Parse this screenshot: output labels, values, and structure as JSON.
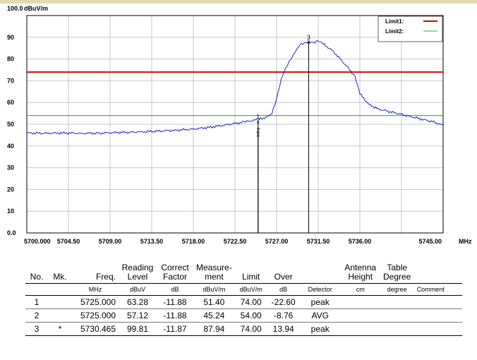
{
  "chart_data": {
    "type": "line",
    "ylabel": "dBuV/m",
    "ylabel_max_tick": "100.0",
    "xlabel": "MHz",
    "ylim": [
      0,
      100
    ],
    "xlim": [
      5700.0,
      5745.0
    ],
    "x_ticks": [
      "5700.000",
      "5704.50",
      "5709.00",
      "5713.50",
      "5718.00",
      "5722.50",
      "5727.00",
      "5731.50",
      "5736.00",
      "5745.00"
    ],
    "x_tick_values": [
      5700.0,
      5704.5,
      5709.0,
      5713.5,
      5718.0,
      5722.5,
      5727.0,
      5731.5,
      5736.0,
      5745.0
    ],
    "y_ticks": [
      "0.0",
      "10",
      "20",
      "30",
      "40",
      "50",
      "60",
      "70",
      "80",
      "90"
    ],
    "y_tick_values": [
      0,
      10,
      20,
      30,
      40,
      50,
      60,
      70,
      80,
      90
    ],
    "grid": true,
    "legend": {
      "placement": "top-right",
      "entries": [
        {
          "name": "Limit1:",
          "color": "#dd0000"
        },
        {
          "name": "Limit2:",
          "color": "#22bb22"
        }
      ]
    },
    "limits": [
      {
        "name": "Limit1:",
        "value": 74,
        "color": "#dd0000"
      },
      {
        "name": "Limit2:",
        "value": 54,
        "color": "#22bb22"
      }
    ],
    "series": [
      {
        "color": "#2222cc",
        "x": [
          5700.0,
          5702.0,
          5704.0,
          5706.0,
          5708.0,
          5710.0,
          5712.0,
          5714.0,
          5716.0,
          5718.0,
          5720.0,
          5722.0,
          5723.5,
          5725.0,
          5726.0,
          5726.5,
          5727.0,
          5727.5,
          5728.0,
          5728.5,
          5729.0,
          5729.5,
          5730.0,
          5730.465,
          5731.0,
          5731.5,
          5732.0,
          5733.0,
          5734.0,
          5735.0,
          5735.5,
          5735.6,
          5736.0,
          5737.0,
          5738.0,
          5739.0,
          5740.0,
          5741.0,
          5742.0,
          5743.0,
          5744.0,
          5745.0
        ],
        "y": [
          46.0,
          45.8,
          46.0,
          45.8,
          45.9,
          46.2,
          46.4,
          46.8,
          47.2,
          47.8,
          48.7,
          50.0,
          51.0,
          52.2,
          53.3,
          55.0,
          62.0,
          71.0,
          76.0,
          79.5,
          83.0,
          86.5,
          87.6,
          88.0,
          87.5,
          88.2,
          87.0,
          84.0,
          79.5,
          74.5,
          72.0,
          70.0,
          64.0,
          59.0,
          57.0,
          56.0,
          55.0,
          54.0,
          53.0,
          52.0,
          51.0,
          49.5
        ]
      }
    ],
    "markers": [
      {
        "label": "1",
        "x": 5725.0,
        "y": 51.4
      },
      {
        "label": "2",
        "x": 5725.0,
        "y": 45.24
      },
      {
        "label": "3",
        "x": 5730.465,
        "y": 87.94
      }
    ]
  },
  "table": {
    "headers": {
      "no": "No.",
      "mk": "Mk.",
      "freq": "Freq.",
      "reading": [
        "Reading",
        "Level"
      ],
      "correct": [
        "Correct",
        "Factor"
      ],
      "measure": [
        "Measure-",
        "ment"
      ],
      "limit": "Limit",
      "over": "Over",
      "detector": "",
      "antenna": [
        "Antenna",
        "Height"
      ],
      "table_deg": [
        "Table",
        "Degree"
      ],
      "comment": ""
    },
    "units": {
      "no": "",
      "mk": "",
      "freq": "MHz",
      "reading": "dBuV",
      "correct": "dB",
      "measure": "dBuV/m",
      "limit": "dBuV/m",
      "over": "dB",
      "detector": "Detector",
      "antenna": "cm",
      "table_deg": "degree",
      "comment": "Comment"
    },
    "rows": [
      {
        "no": "1",
        "mk": "",
        "freq": "5725.000",
        "reading": "63.28",
        "correct": "-11.88",
        "measure": "51.40",
        "limit": "74.00",
        "over": "-22.60",
        "detector": "peak",
        "antenna": "",
        "table_deg": "",
        "comment": ""
      },
      {
        "no": "2",
        "mk": "",
        "freq": "5725.000",
        "reading": "57.12",
        "correct": "-11.88",
        "measure": "45.24",
        "limit": "54.00",
        "over": "-8.76",
        "detector": "AVG",
        "antenna": "",
        "table_deg": "",
        "comment": ""
      },
      {
        "no": "3",
        "mk": "*",
        "freq": "5730.465",
        "reading": "99.81",
        "correct": "-11.87",
        "measure": "87.94",
        "limit": "74.00",
        "over": "13.94",
        "detector": "peak",
        "antenna": "",
        "table_deg": "",
        "comment": ""
      }
    ]
  }
}
